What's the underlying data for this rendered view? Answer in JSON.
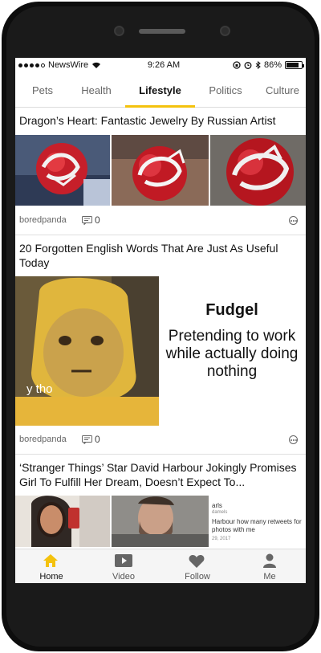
{
  "status": {
    "carrier": "NewsWire",
    "time": "9:26 AM",
    "battery": "86%",
    "battery_level": 0.86
  },
  "tabs": [
    {
      "label": "Pets"
    },
    {
      "label": "Health"
    },
    {
      "label": "Lifestyle",
      "active": true
    },
    {
      "label": "Politics"
    },
    {
      "label": "Culture"
    }
  ],
  "articles": [
    {
      "title": "Dragon’s Heart: Fantastic Jewelry By Russian Artist",
      "source": "boredpanda",
      "comments": "0"
    },
    {
      "title": "20 Forgotten English Words That Are Just As Useful Today",
      "source": "boredpanda",
      "comments": "0",
      "meme_caption": "y tho",
      "meme_title": "Fudgel",
      "meme_text": "Pretending to work while actually doing nothing"
    },
    {
      "title": "‘Stranger Things’ Star David Harbour Jokingly Promises Girl To Fulfill Her Dream, Doesn’t Expect To...",
      "tweet_name": "arls",
      "tweet_handle": "damels",
      "tweet_text": "Harbour how many retweets for photos with me",
      "tweet_date": "29, 2017"
    }
  ],
  "bottom_nav": [
    {
      "label": "Home",
      "icon": "home-icon",
      "active": true
    },
    {
      "label": "Video",
      "icon": "video-icon"
    },
    {
      "label": "Follow",
      "icon": "heart-icon"
    },
    {
      "label": "Me",
      "icon": "person-icon"
    }
  ],
  "colors": {
    "accent": "#f4c20d"
  }
}
